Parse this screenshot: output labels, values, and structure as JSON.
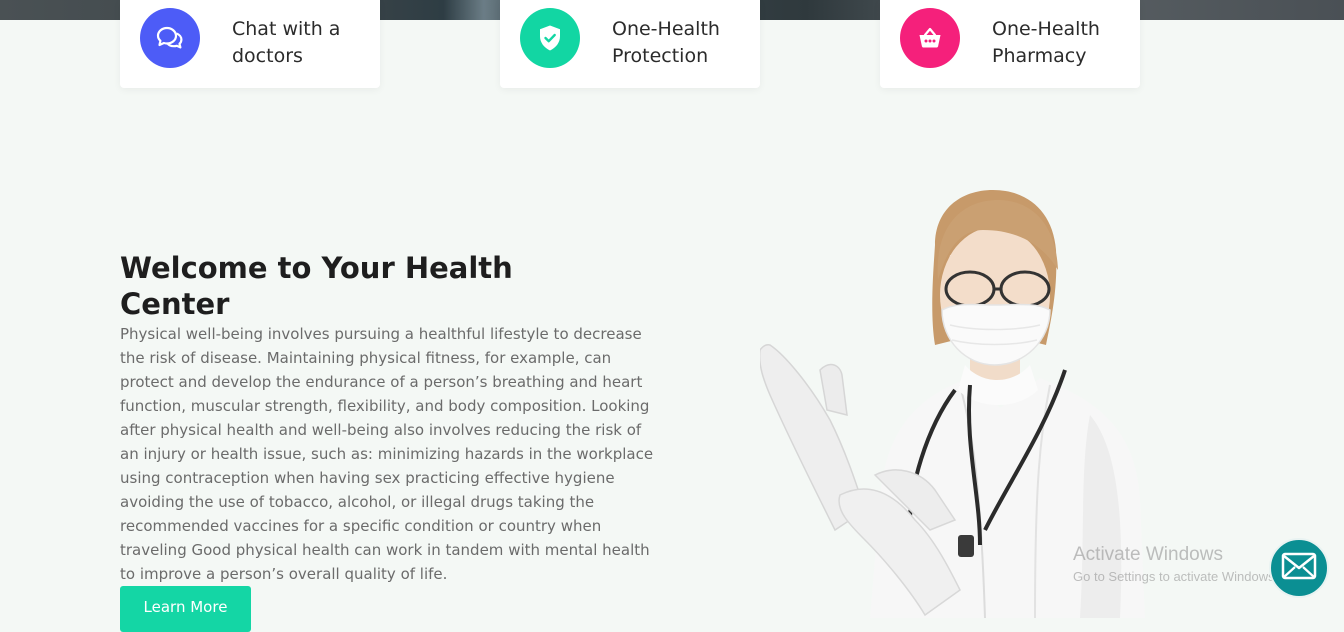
{
  "features": [
    {
      "label_line1": "Chat with a",
      "label_line2": "doctors",
      "icon": "chat-bubbles-icon",
      "color": "#4d5cf7"
    },
    {
      "label_line1": "One-Health",
      "label_line2": "Protection",
      "icon": "shield-check-icon",
      "color": "#12d6a3"
    },
    {
      "label_line1": "One-Health",
      "label_line2": "Pharmacy",
      "icon": "shopping-basket-icon",
      "color": "#f5207b"
    }
  ],
  "welcome": {
    "title_line1": "Welcome to Your Health",
    "title_line2": "Center",
    "body": "Physical well-being involves pursuing a healthful lifestyle to decrease the risk of disease. Maintaining physical fitness, for example, can protect and develop the endurance of a person’s breathing and heart function, muscular strength, flexibility, and body composition. Looking after physical health and well-being also involves reducing the risk of an injury or health issue, such as: minimizing hazards in the workplace using contraception when having sex practicing effective hygiene avoiding the use of tobacco, alcohol, or illegal drugs taking the recommended vaccines for a specific condition or country when traveling Good physical health can work in tandem with mental health to improve a person’s overall quality of life.",
    "button_label": "Learn More"
  },
  "watermark": {
    "line1": "Activate Windows",
    "line2": "Go to Settings to activate Windows."
  },
  "colors": {
    "accent": "#14d6a5",
    "fab": "#0b8f93",
    "background": "#f4f8f5"
  }
}
